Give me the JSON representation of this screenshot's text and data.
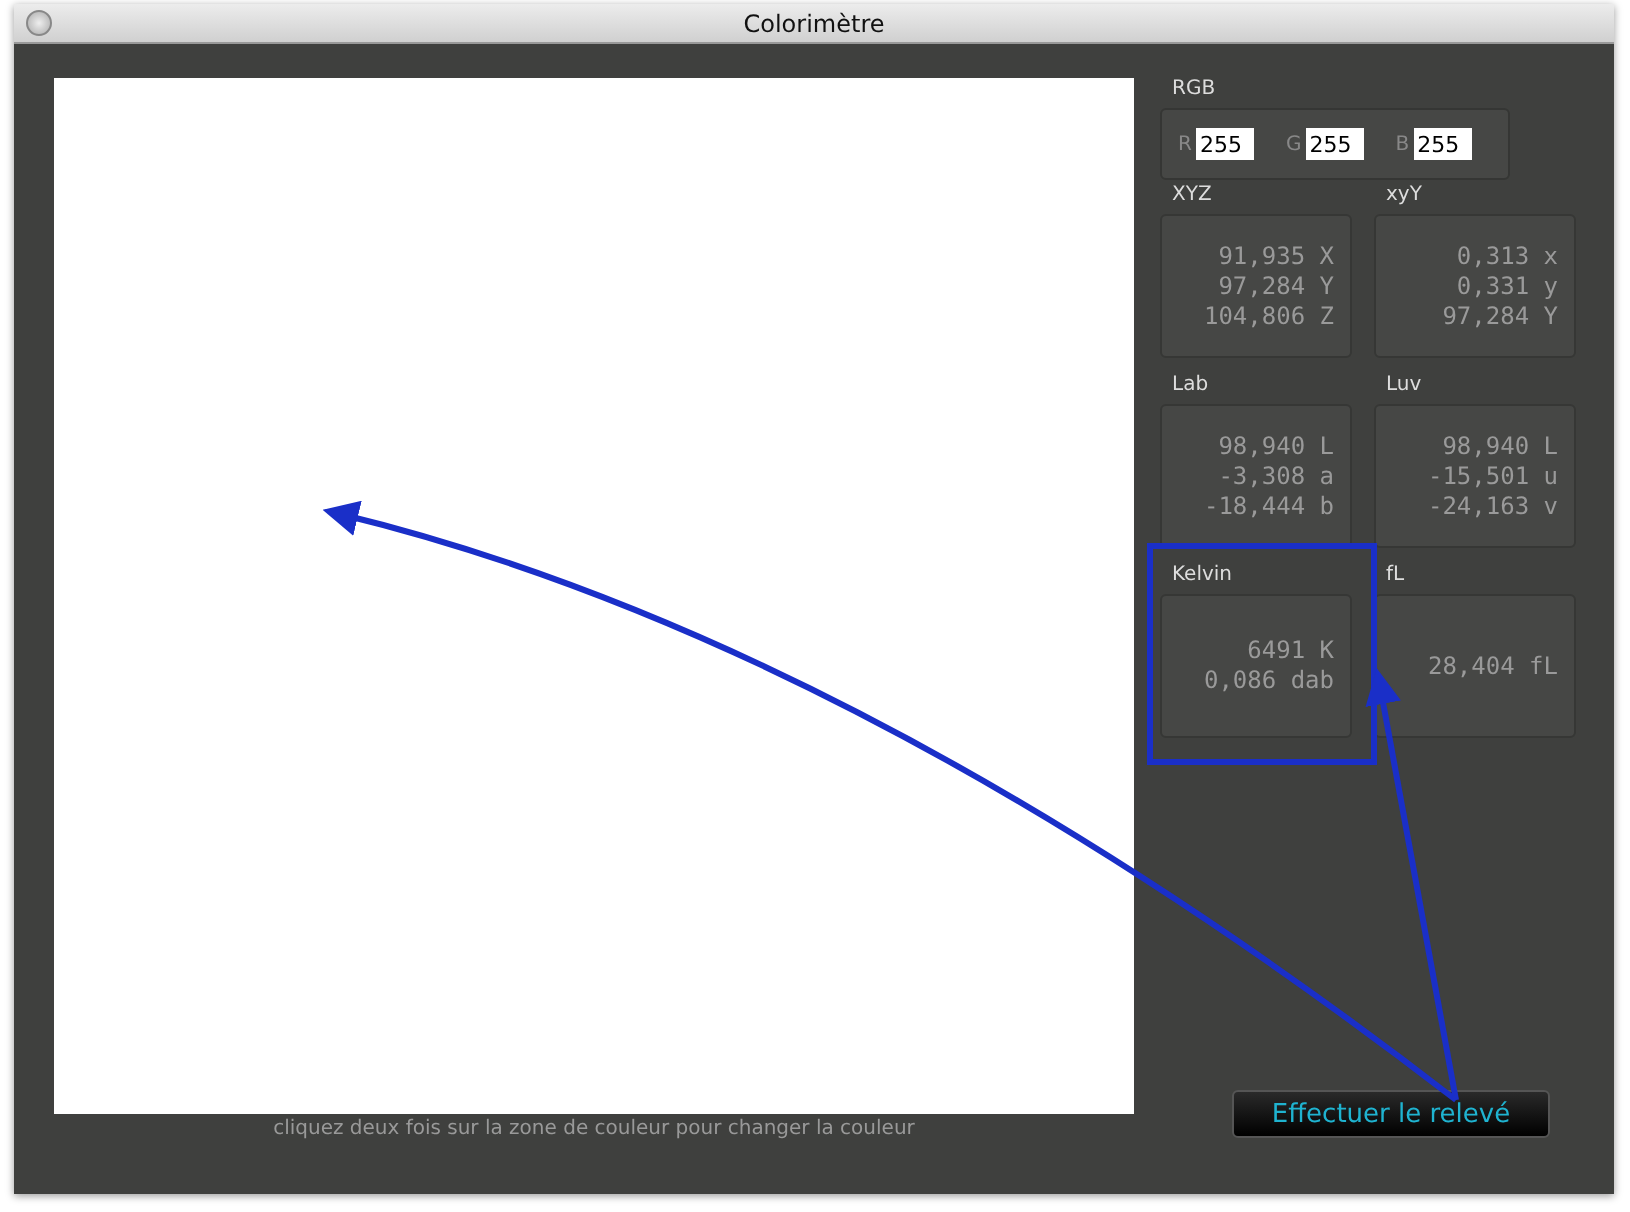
{
  "window": {
    "title": "Colorimètre"
  },
  "rgb": {
    "title": "RGB",
    "fields": [
      {
        "label": "R",
        "value": "255"
      },
      {
        "label": "G",
        "value": "255"
      },
      {
        "label": "B",
        "value": "255"
      }
    ]
  },
  "panels": [
    {
      "title": "XYZ",
      "lines": [
        {
          "value": "91,935",
          "unit": "X"
        },
        {
          "value": "97,284",
          "unit": "Y"
        },
        {
          "value": "104,806",
          "unit": "Z"
        }
      ]
    },
    {
      "title": "xyY",
      "lines": [
        {
          "value": "0,313",
          "unit": "x"
        },
        {
          "value": "0,331",
          "unit": "y"
        },
        {
          "value": "97,284",
          "unit": "Y"
        }
      ]
    },
    {
      "title": "Lab",
      "lines": [
        {
          "value": "98,940",
          "unit": "L"
        },
        {
          "value": "-3,308",
          "unit": "a"
        },
        {
          "value": "-18,444",
          "unit": "b"
        }
      ]
    },
    {
      "title": "Luv",
      "lines": [
        {
          "value": "98,940",
          "unit": "L"
        },
        {
          "value": "-15,501",
          "unit": "u"
        },
        {
          "value": "-24,163",
          "unit": "v"
        }
      ]
    },
    {
      "title": "Kelvin",
      "lines": [
        {
          "value": "6491",
          "unit": "K"
        },
        {
          "value": "0,086",
          "unit": "dab"
        }
      ]
    },
    {
      "title": "fL",
      "lines": [
        {
          "value": "28,404",
          "unit": "fL"
        }
      ]
    }
  ],
  "hint": "cliquez deux fois sur la zone de couleur pour changer la couleur",
  "button": "Effectuer le relevé"
}
